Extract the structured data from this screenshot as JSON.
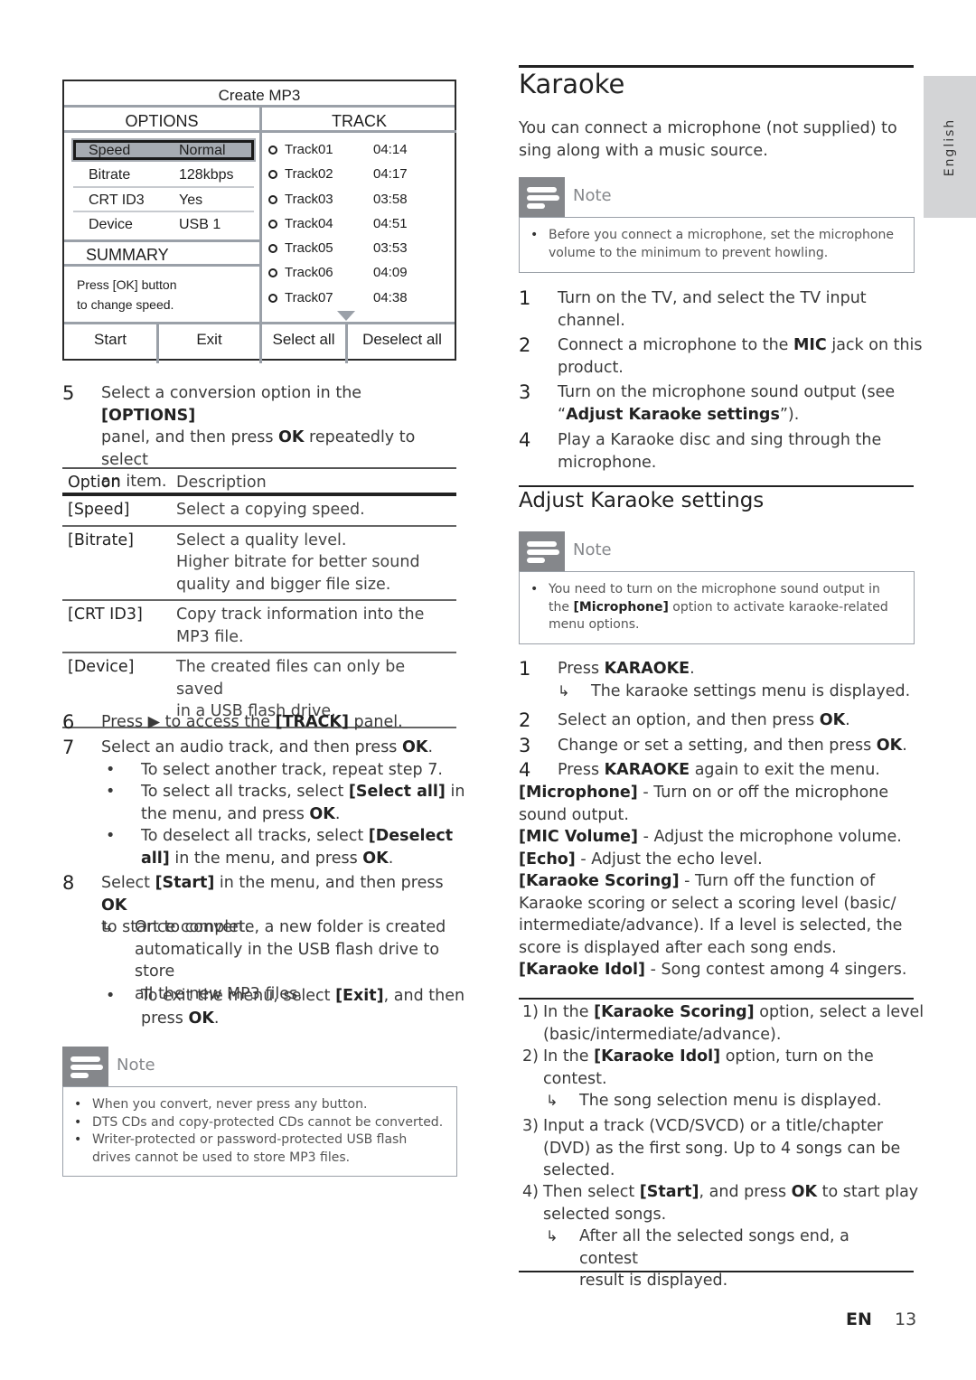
{
  "osd_menu": {
    "title": "Create MP3",
    "options_header": "OPTIONS",
    "track_header": "TRACK",
    "options": [
      {
        "key": "Speed",
        "value": "Normal",
        "selected": true
      },
      {
        "key": "Bitrate",
        "value": "128kbps",
        "selected": false
      },
      {
        "key": "CRT ID3",
        "value": "Yes",
        "selected": false
      },
      {
        "key": "Device",
        "value": "USB 1",
        "selected": false
      }
    ],
    "summary_label": "SUMMARY",
    "hint_line1": "Press [OK] button",
    "hint_line2": "to change speed.",
    "tracks": [
      {
        "name": "Track01",
        "time": "04:14"
      },
      {
        "name": "Track02",
        "time": "04:17"
      },
      {
        "name": "Track03",
        "time": "03:58"
      },
      {
        "name": "Track04",
        "time": "04:51"
      },
      {
        "name": "Track05",
        "time": "03:53"
      },
      {
        "name": "Track06",
        "time": "04:09"
      },
      {
        "name": "Track07",
        "time": "04:38"
      }
    ],
    "buttons": {
      "start": "Start",
      "exit": "Exit",
      "select_all": "Select all",
      "deselect_all": "Deselect all"
    }
  },
  "left": {
    "step5": {
      "num": "5",
      "text_html": "Select a conversion option in the <b>[OPTIONS]</b><br>panel, and then press <b>OK</b> repeatedly to select<br>an item."
    },
    "option_table": {
      "headers": [
        "Option",
        "Description"
      ],
      "rows": [
        {
          "option": "[Speed]",
          "description_html": "Select a copying speed."
        },
        {
          "option": "[Bitrate]",
          "description_html": "Select a quality level.<br>Higher bitrate for better sound<br>quality and bigger file size."
        },
        {
          "option": "[CRT ID3]",
          "description_html": "Copy track information into the<br>MP3 file."
        },
        {
          "option": "[Device]",
          "description_html": "The created files can only be saved<br>in a USB flash drive."
        }
      ]
    },
    "step6": {
      "num": "6",
      "text_html": "Press &#9654; to access the <b>[TRACK]</b> panel."
    },
    "step7": {
      "num": "7",
      "text_html": "Select an audio track, and then press <b>OK</b>."
    },
    "step7_bullets": [
      {
        "mark": "•",
        "text_html": "To select another track, repeat step 7."
      },
      {
        "mark": "•",
        "text_html": "To select all tracks, select <b>[Select all]</b> in<br>the menu, and press <b>OK</b>."
      },
      {
        "mark": "•",
        "text_html": "To deselect all tracks, select <b>[Deselect<br>all]</b> in the menu, and press <b>OK</b>."
      }
    ],
    "step8": {
      "num": "8",
      "text_html": "Select <b>[Start]</b> in the menu, and then press <b>OK</b><br>to start to convert."
    },
    "step8_result": {
      "mark": "↳",
      "text_html": "Once complete, a new folder is created<br>automatically in the USB flash drive to store<br>all the new MP3 files."
    },
    "step8_bullet": {
      "mark": "•",
      "text_html": "To exit the menu, select <b>[Exit]</b>, and then<br>press <b>OK</b>."
    },
    "note": {
      "label": "Note",
      "items": [
        "When you convert, never press any button.",
        "DTS CDs and copy-protected CDs cannot be converted.",
        "Writer-protected or password-protected USB flash drives cannot be used to store MP3 files."
      ]
    }
  },
  "right": {
    "title": "Karaoke",
    "intro": "You can connect a microphone (not supplied) to sing along with a music source.",
    "note1": {
      "label": "Note",
      "items_html": [
        "Before you connect a microphone, set the microphone<br>volume to the minimum to prevent howling."
      ]
    },
    "steps": [
      {
        "num": "1",
        "text_html": "Turn on the TV, and select the TV input<br>channel."
      },
      {
        "num": "2",
        "text_html": "Connect a microphone to the <b>MIC</b> jack on this<br>product."
      },
      {
        "num": "3",
        "text_html": "Turn on the microphone sound output (see<br>“<b>Adjust Karaoke settings</b>”)."
      },
      {
        "num": "4",
        "text_html": "Play a Karaoke disc and sing through the<br>microphone."
      }
    ],
    "subtitle": "Adjust Karaoke settings",
    "note2": {
      "label": "Note",
      "items_html": [
        "You need to turn on the microphone sound output in<br>the <b>[Microphone]</b> option to activate karaoke-related<br>menu options."
      ]
    },
    "adjust_steps": [
      {
        "num": "1",
        "text_html": "Press <b>KARAOKE</b>."
      },
      {
        "num": "2",
        "text_html": "Select an option, and then press <b>OK</b>."
      },
      {
        "num": "3",
        "text_html": "Change or set a setting, and then press <b>OK</b>."
      },
      {
        "num": "4",
        "text_html": "Press <b>KARAOKE</b> again to exit the menu."
      }
    ],
    "adjust_step1_result": {
      "mark": "↳",
      "text": "The karaoke settings menu is displayed."
    },
    "settings_html": "<b>[Microphone]</b> - Turn on or off the microphone<br>sound output.<br><b>[MIC Volume]</b> - Adjust the microphone volume.<br><b>[Echo]</b> - Adjust the echo level.<br><b>[Karaoke Scoring]</b> - Turn off the function of<br>Karaoke scoring or select a scoring level (basic/<br>intermediate/advance). If a level is selected, the<br>score is displayed after each song ends.<br><b>[Karaoke Idol]</b> - Song contest among 4 singers.",
    "contest_steps": [
      {
        "num": "1)",
        "text_html": "In the <b>[Karaoke Scoring]</b> option, select a level<br>(basic/intermediate/advance)."
      },
      {
        "num": "2)",
        "text_html": "In the <b>[Karaoke Idol]</b> option, turn on the<br>contest."
      },
      {
        "num": "3)",
        "text_html": "Input a track (VCD/SVCD) or a title/chapter<br>(DVD) as the first song. Up to 4 songs can be<br>selected."
      },
      {
        "num": "4)",
        "text_html": "Then select <b>[Start]</b>, and press <b>OK</b> to start play<br>selected songs."
      }
    ],
    "contest2_result": {
      "mark": "↳",
      "text": "The song selection menu is displayed."
    },
    "contest4_result": {
      "mark": "↳",
      "text_html": "After all the selected songs end, a contest<br>result is displayed."
    }
  },
  "side_tab": {
    "label": "English"
  },
  "footer": {
    "lang": "EN",
    "page": "13"
  }
}
